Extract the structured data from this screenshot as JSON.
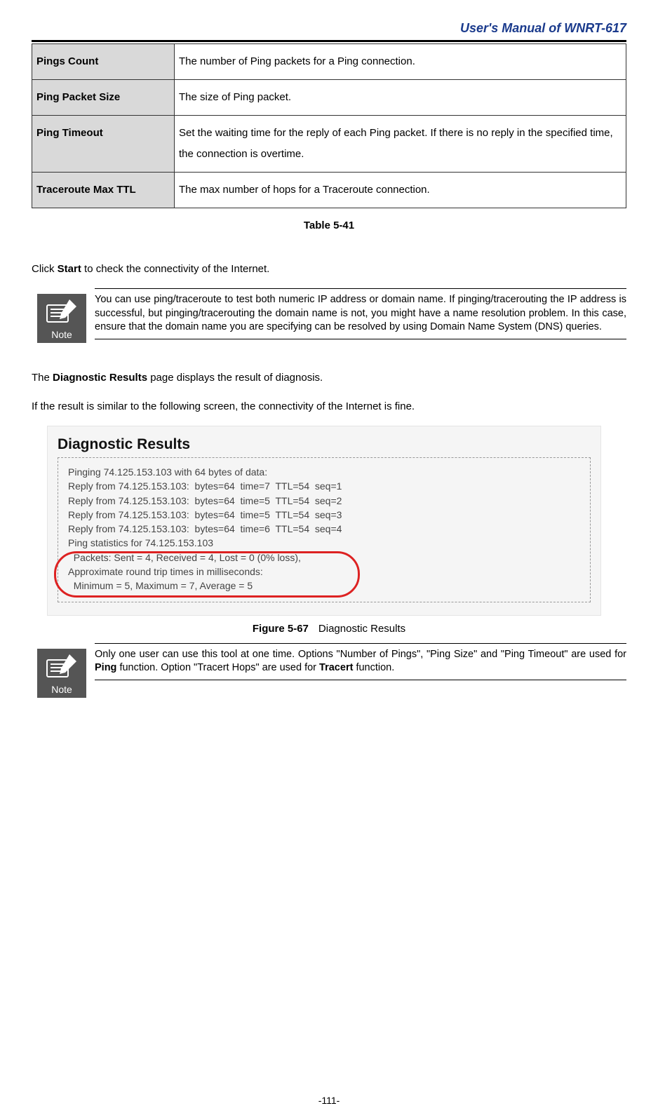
{
  "header": {
    "title": "User's Manual of WNRT-617"
  },
  "table": {
    "rows": [
      {
        "label": "Pings Count",
        "desc": "The number of Ping packets for a Ping connection."
      },
      {
        "label": "Ping Packet Size",
        "desc": "The size of Ping packet."
      },
      {
        "label": "Ping Timeout",
        "desc": "Set the waiting time for the reply of each Ping packet. If there is no reply in the specified time, the connection is overtime."
      },
      {
        "label": "Traceroute Max TTL",
        "desc": "The max number of hops for a Traceroute connection."
      }
    ],
    "caption": "Table 5-41"
  },
  "start_line": {
    "pre": "Click ",
    "bold": "Start",
    "post": " to check the connectivity of the Internet."
  },
  "note1": {
    "label": "Note",
    "text": "You can use ping/traceroute to test both numeric IP address or domain name. If pinging/tracerouting the IP address is successful, but pinging/tracerouting the domain name is not, you might have a name resolution problem. In this case, ensure that the domain name you are specifying can be resolved by using Domain Name System (DNS) queries."
  },
  "diag_intro1": {
    "pre": "The ",
    "bold": "Diagnostic Results",
    "post": " page displays the result of diagnosis."
  },
  "diag_intro2": "If the result is similar to the following screen, the connectivity of the Internet is fine.",
  "diag": {
    "title": "Diagnostic Results",
    "lines": [
      "Pinging 74.125.153.103 with 64 bytes of data:",
      "",
      "Reply from 74.125.153.103:  bytes=64  time=7  TTL=54  seq=1",
      "Reply from 74.125.153.103:  bytes=64  time=5  TTL=54  seq=2",
      "Reply from 74.125.153.103:  bytes=64  time=5  TTL=54  seq=3",
      "Reply from 74.125.153.103:  bytes=64  time=6  TTL=54  seq=4",
      "",
      "Ping statistics for 74.125.153.103",
      "  Packets: Sent = 4, Received = 4, Lost = 0 (0% loss),",
      "Approximate round trip times in milliseconds:",
      "  Minimum = 5, Maximum = 7, Average = 5"
    ]
  },
  "figure": {
    "num": "Figure 5-67",
    "caption": "Diagnostic Results"
  },
  "note2": {
    "label": "Note",
    "pre": "Only one user can use this tool at one time. Options \"Number of Pings\", \"Ping Size\" and \"Ping Timeout\" are used for ",
    "b1": "Ping",
    "mid": " function. Option \"Tracert Hops\" are used for ",
    "b2": "Tracert",
    "post": " function."
  },
  "page_number": "-111-"
}
